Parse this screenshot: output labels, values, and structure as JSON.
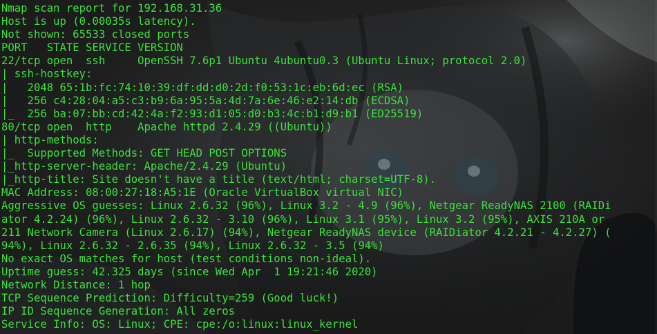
{
  "terminal": {
    "text_color": "#3ae33a",
    "background_color": "#1c1c1c",
    "lines": [
      "Nmap scan report for 192.168.31.36",
      "Host is up (0.00035s latency).",
      "Not shown: 65533 closed ports",
      "PORT   STATE SERVICE VERSION",
      "22/tcp open  ssh     OpenSSH 7.6p1 Ubuntu 4ubuntu0.3 (Ubuntu Linux; protocol 2.0)",
      "| ssh-hostkey:",
      "|   2048 65:1b:fc:74:10:39:df:dd:d0:2d:f0:53:1c:eb:6d:ec (RSA)",
      "|   256 c4:28:04:a5:c3:b9:6a:95:5a:4d:7a:6e:46:e2:14:db (ECDSA)",
      "|_  256 ba:07:bb:cd:42:4a:f2:93:d1:05:d0:b3:4c:b1:d9:b1 (ED25519)",
      "80/tcp open  http    Apache httpd 2.4.29 ((Ubuntu))",
      "| http-methods:",
      "|_  Supported Methods: GET HEAD POST OPTIONS",
      "|_http-server-header: Apache/2.4.29 (Ubuntu)",
      "|_http-title: Site doesn't have a title (text/html; charset=UTF-8).",
      "MAC Address: 08:00:27:18:A5:1E (Oracle VirtualBox virtual NIC)",
      "Aggressive OS guesses: Linux 2.6.32 (96%), Linux 3.2 - 4.9 (96%), Netgear ReadyNAS 2100 (RAIDi",
      "ator 4.2.24) (96%), Linux 2.6.32 - 3.10 (96%), Linux 3.1 (95%), Linux 3.2 (95%), AXIS 210A or",
      "211 Network Camera (Linux 2.6.17) (94%), Netgear ReadyNAS device (RAIDiator 4.2.21 - 4.2.27) (",
      "94%), Linux 2.6.32 - 2.6.35 (94%), Linux 2.6.32 - 3.5 (94%)",
      "No exact OS matches for host (test conditions non-ideal).",
      "Uptime guess: 42.325 days (since Wed Apr  1 19:21:46 2020)",
      "Network Distance: 1 hop",
      "TCP Sequence Prediction: Difficulty=259 (Good luck!)",
      "IP ID Sequence Generation: All zeros",
      "Service Info: OS: Linux; CPE: cpe:/o:linux:linux_kernel"
    ]
  }
}
